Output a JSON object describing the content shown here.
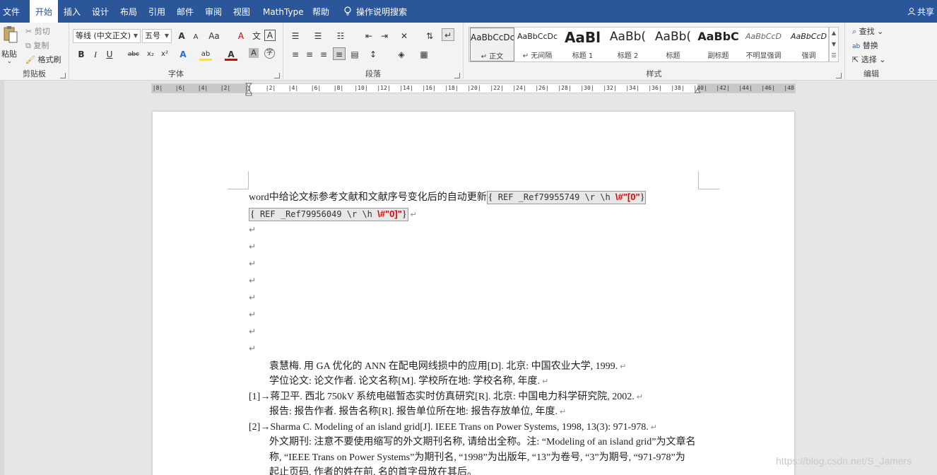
{
  "menu": {
    "items": [
      "文件",
      "开始",
      "插入",
      "设计",
      "布局",
      "引用",
      "邮件",
      "审阅",
      "视图",
      "MathType",
      "帮助"
    ],
    "active": "开始",
    "tell_me": "操作说明搜索",
    "share": "共享"
  },
  "clipboard": {
    "paste": "粘贴",
    "cut": "剪切",
    "copy": "复制",
    "format_painter": "格式刷",
    "group_label": "剪贴板"
  },
  "font": {
    "font_name": "等线 (中文正文)",
    "font_size": "五号",
    "grow": "A",
    "shrink": "A",
    "change_case": "Aa",
    "clear": "A",
    "phonetic": "文",
    "border": "A",
    "bold": "B",
    "italic": "I",
    "underline": "U",
    "strike": "abc",
    "subscript": "x₂",
    "superscript": "x²",
    "text_effect": "A",
    "highlight": "ab",
    "font_color": "A",
    "shading": "A",
    "enclose": "字",
    "group_label": "字体"
  },
  "paragraph": {
    "group_label": "段落"
  },
  "styles": {
    "tiles": [
      {
        "sample": "AaBbCcDc",
        "name": "正文",
        "selected": true
      },
      {
        "sample": "AaBbCcDc",
        "name": "无间隔",
        "selected": false
      },
      {
        "sample": "AaBl",
        "name": "标题 1",
        "selected": false
      },
      {
        "sample": "AaBb(",
        "name": "标题 2",
        "selected": false
      },
      {
        "sample": "AaBb(",
        "name": "标题",
        "selected": false
      },
      {
        "sample": "AaBbC",
        "name": "副标题",
        "selected": false
      },
      {
        "sample": "AaBbCcD",
        "name": "不明显强调",
        "selected": false
      },
      {
        "sample": "AaBbCcD",
        "name": "强调",
        "selected": false
      }
    ],
    "group_label": "样式"
  },
  "editing": {
    "find": "查找",
    "replace": "替换",
    "select": "选择",
    "group_label": "编辑"
  },
  "ruler": {
    "labels": [
      "8",
      "6",
      "4",
      "2",
      "",
      "2",
      "4",
      "6",
      "8",
      "10",
      "12",
      "14",
      "16",
      "18",
      "20",
      "22",
      "24",
      "26",
      "28",
      "30",
      "32",
      "34",
      "36",
      "38",
      "40",
      "42",
      "44",
      "46",
      "48"
    ]
  },
  "document": {
    "title_text": "word中给论文标参考文献和文献序号变化后的自动更新",
    "field1_code": " REF _Ref79955749 \\r \\h ",
    "field1_switch": "\\#\"[0\"",
    "field2_code": " REF _Ref79956049 \\r \\h ",
    "field2_switch": "\\#\"0]\"",
    "ref_prefix": "REF",
    "para_mark": "↵",
    "lines": [
      "袁慧梅. 用 GA 优化的 ANN 在配电网线损中的应用[D]. 北京: 中国农业大学, 1999.",
      "学位论文: 论文作者. 论文名称[M]. 学校所在地: 学校名称, 年度.",
      "[1]→蒋卫平. 西北 750kV 系统电磁暂态实时仿真研究[R]. 北京: 中国电力科学研究院, 2002.",
      "报告: 报告作者. 报告名称[R]. 报告单位所在地: 报告存放单位, 年度.",
      "[2]→Sharma C. Modeling of an island grid[J]. IEEE Trans on Power Systems, 1998, 13(3): 971-978.",
      "外文期刊: 注意不要使用缩写的外文期刊名称, 请给出全称。注: “Modeling of an island grid”为文章名",
      "称, “IEEE Trans on Power Systems”为期刊名, “1998”为出版年, “13”为卷号, “3”为期号, “971-978”为",
      "起止页码, 作者的姓在前, 名的首字母放在其后。"
    ]
  },
  "watermark": "https://blog.csdn.net/S_Jamers",
  "colors": {
    "ribbon_blue": "#2b579a",
    "field_red": "#e00000"
  }
}
